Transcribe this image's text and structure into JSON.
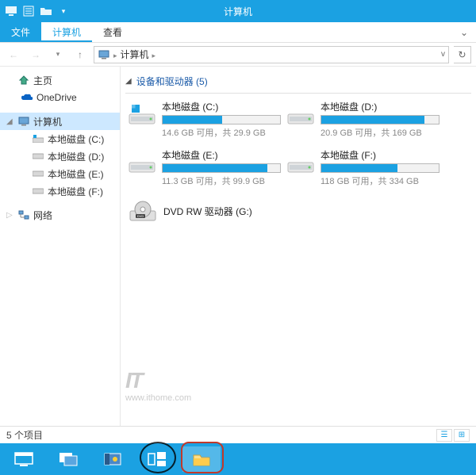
{
  "window": {
    "title": "计算机"
  },
  "ribbon": {
    "file": "文件",
    "tabs": [
      "计算机",
      "查看"
    ]
  },
  "address": {
    "path": "计算机",
    "sep": "▸"
  },
  "nav": {
    "home": "主页",
    "onedrive": "OneDrive",
    "computer": "计算机",
    "drives": [
      "本地磁盘 (C:)",
      "本地磁盘 (D:)",
      "本地磁盘 (E:)",
      "本地磁盘 (F:)"
    ],
    "network": "网络"
  },
  "group": {
    "header": "设备和驱动器 (5)"
  },
  "drives": [
    {
      "name": "本地磁盘 (C:)",
      "sub": "14.6 GB 可用，共 29.9 GB",
      "fill": 51,
      "os": true
    },
    {
      "name": "本地磁盘 (D:)",
      "sub": "20.9 GB 可用，共 169 GB",
      "fill": 88,
      "os": false
    },
    {
      "name": "本地磁盘 (E:)",
      "sub": "11.3 GB 可用，共 99.9 GB",
      "fill": 89,
      "os": false
    },
    {
      "name": "本地磁盘 (F:)",
      "sub": "118 GB 可用，共 334 GB",
      "fill": 65,
      "os": false
    }
  ],
  "optical": {
    "name": "DVD RW 驱动器 (G:)"
  },
  "status": {
    "text": "5 个项目"
  },
  "watermark": {
    "logo": "IT",
    "url": "www.ithome.com"
  }
}
